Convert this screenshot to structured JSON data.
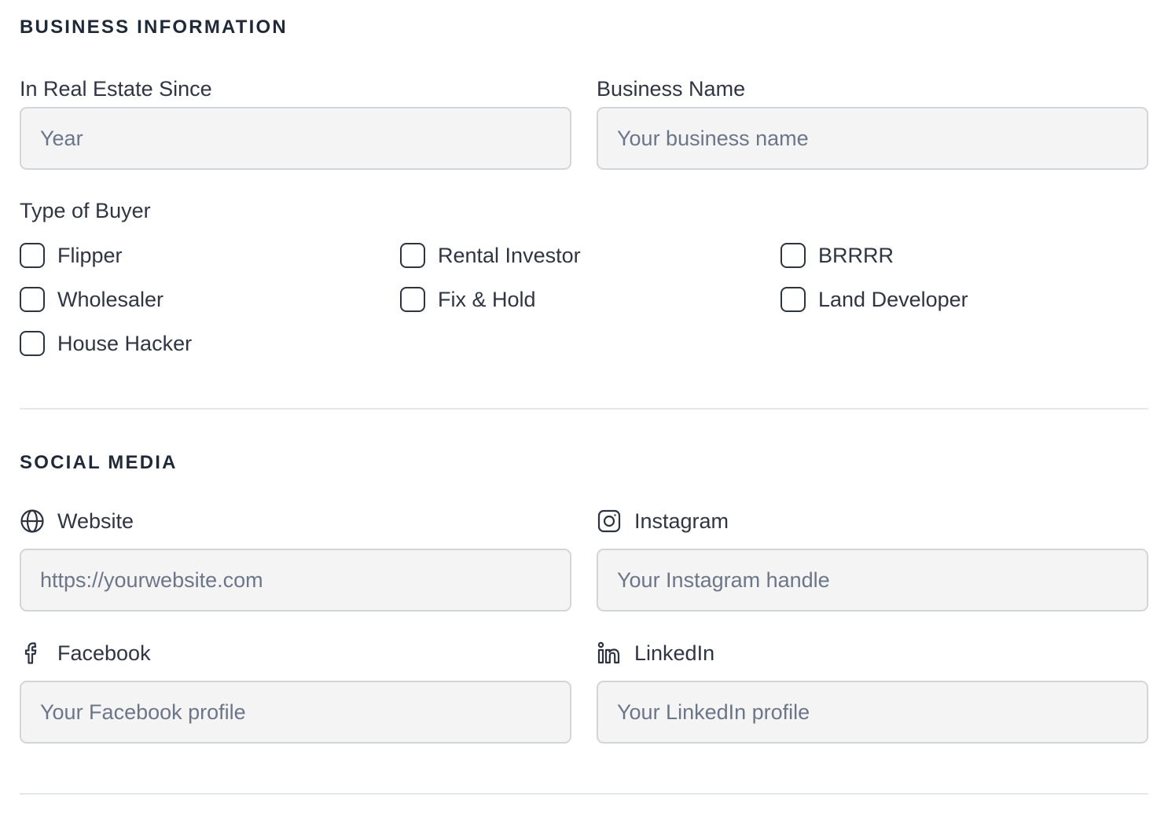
{
  "business": {
    "title": "BUSINESS INFORMATION",
    "since": {
      "label": "In Real Estate Since",
      "placeholder": "Year",
      "value": ""
    },
    "name": {
      "label": "Business Name",
      "placeholder": "Your business name",
      "value": ""
    },
    "buyer_type": {
      "label": "Type of Buyer",
      "options": [
        {
          "label": "Flipper",
          "checked": false
        },
        {
          "label": "Rental Investor",
          "checked": false
        },
        {
          "label": "BRRRR",
          "checked": false
        },
        {
          "label": "Wholesaler",
          "checked": false
        },
        {
          "label": "Fix & Hold",
          "checked": false
        },
        {
          "label": "Land Developer",
          "checked": false
        },
        {
          "label": "House Hacker",
          "checked": false
        }
      ]
    }
  },
  "social": {
    "title": "SOCIAL MEDIA",
    "website": {
      "label": "Website",
      "icon": "globe-icon",
      "placeholder": "https://yourwebsite.com"
    },
    "instagram": {
      "label": "Instagram",
      "icon": "instagram-icon",
      "placeholder": "Your Instagram handle"
    },
    "facebook": {
      "label": "Facebook",
      "icon": "facebook-icon",
      "placeholder": "Your Facebook profile"
    },
    "linkedin": {
      "label": "LinkedIn",
      "icon": "linkedin-icon",
      "placeholder": "Your LinkedIn profile"
    }
  },
  "colors": {
    "text": "#2f3542",
    "heading": "#1f2937",
    "input_bg": "#f4f4f5",
    "input_border": "#d3d5d9",
    "placeholder": "#6c7688",
    "divider": "#e5e7eb"
  }
}
